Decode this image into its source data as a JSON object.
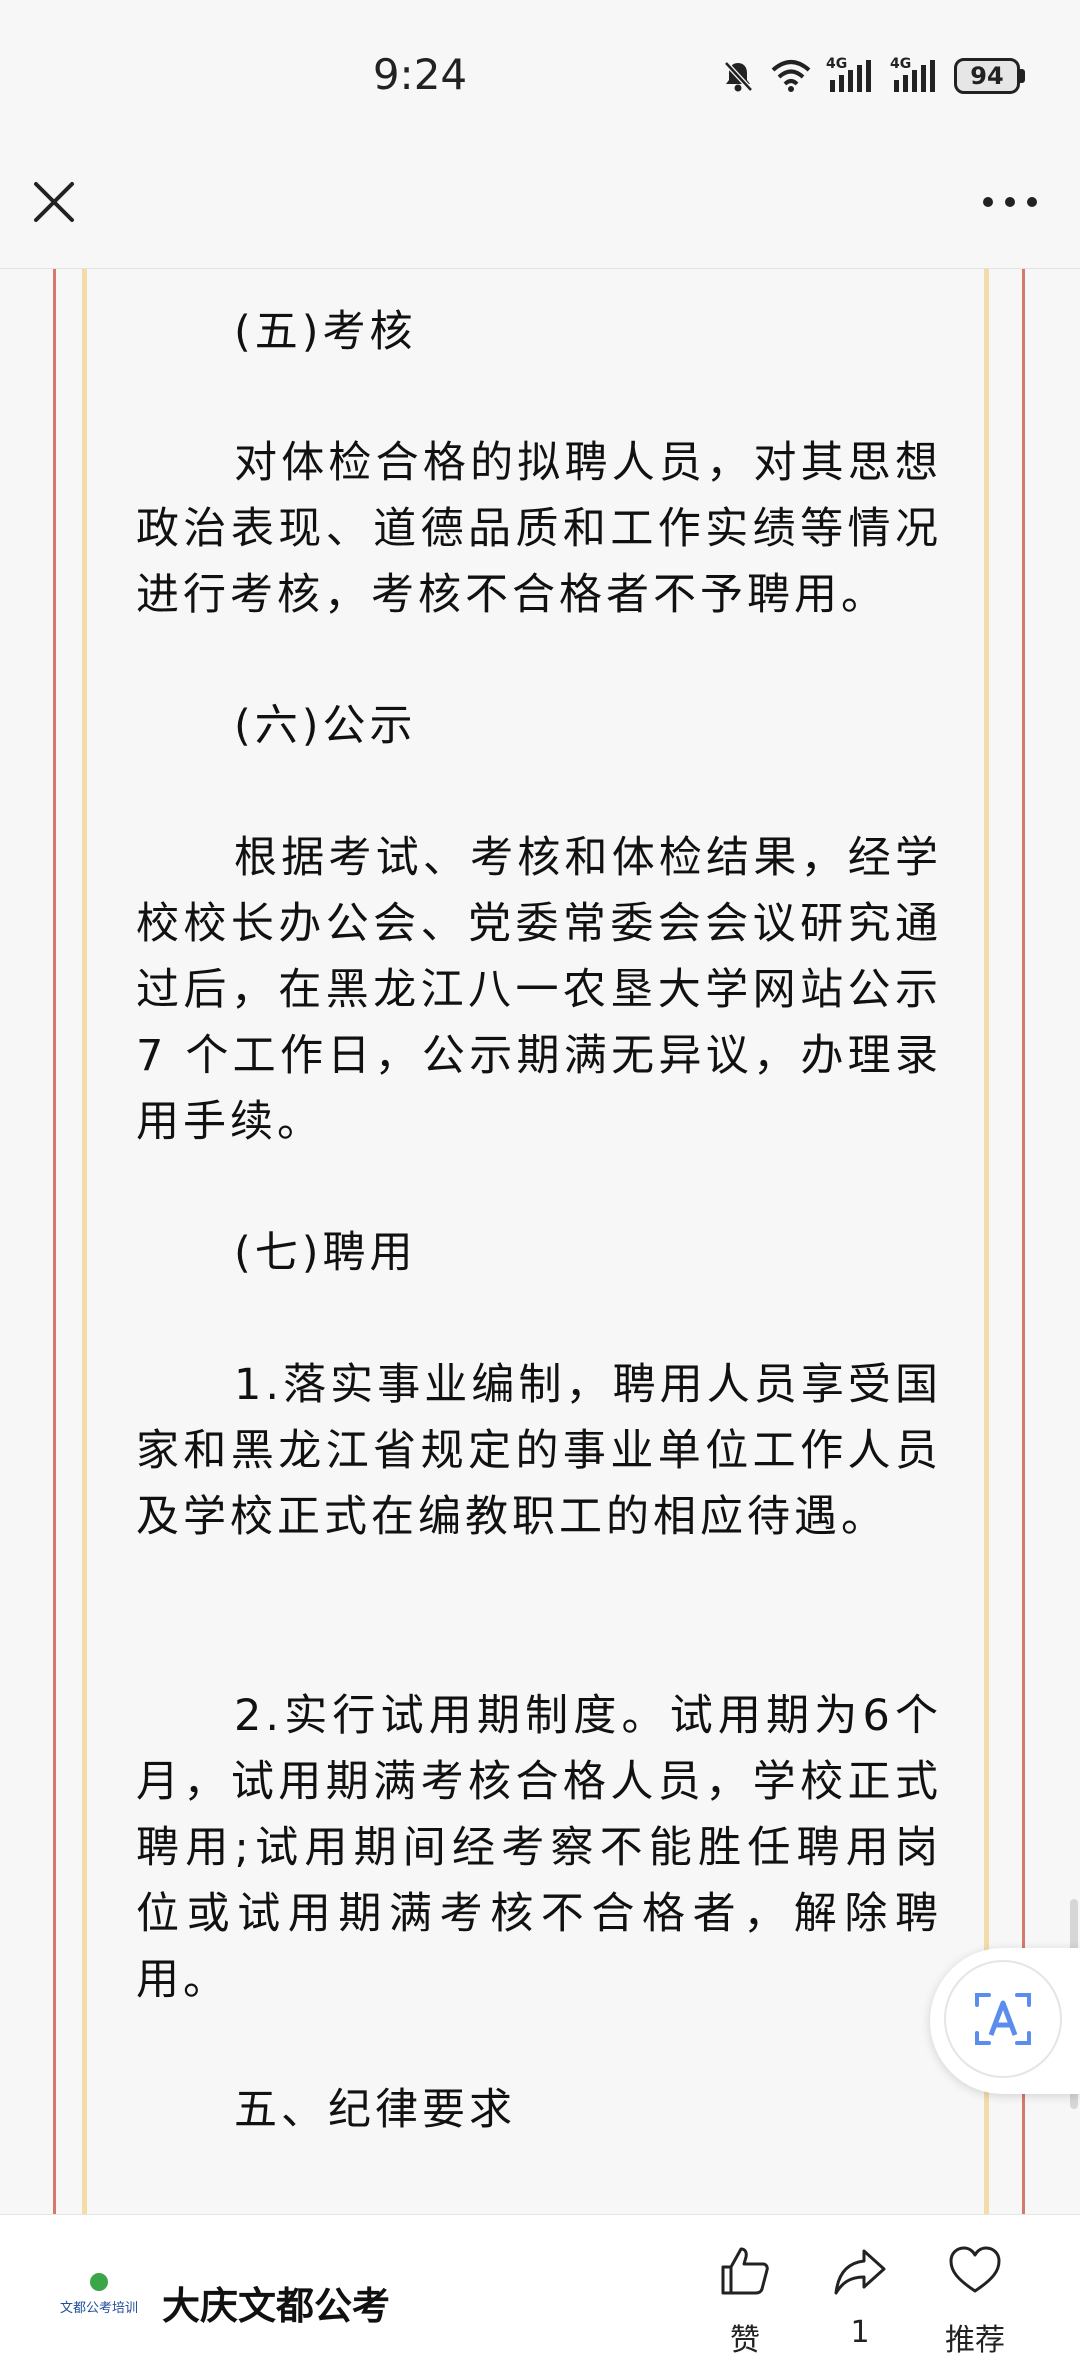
{
  "status": {
    "time": "9:24",
    "battery": "94",
    "network_1": "4G",
    "network_2": "4G"
  },
  "icons": {
    "close": "close-icon",
    "more": "more-icon",
    "like": "thumbs-up-icon",
    "share": "share-icon",
    "recommend": "heart-icon",
    "translate": "translate-icon",
    "mute": "bell-muted-icon",
    "wifi": "wifi-icon"
  },
  "article": {
    "paragraphs": [
      "(五)考核",
      "对体检合格的拟聘人员，对其思想政治表现、道德品质和工作实绩等情况进行考核，考核不合格者不予聘用。",
      "(六)公示",
      "根据考试、考核和体检结果，经学校校长办公会、党委常委会会议研究通过后，在黑龙江八一农垦大学网站公示7 个工作日，公示期满无异议，办理录用手续。",
      "(七)聘用",
      "1.落实事业编制，聘用人员享受国家和黑龙江省规定的事业单位工作人员及学校正式在编教职工的相应待遇。",
      "2.实行试用期制度。试用期为6个月，试用期满考核合格人员，学校正式聘用;试用期间经考察不能胜任聘用岗位或试用期满考核不合格者，解除聘用。",
      "五、纪律要求"
    ]
  },
  "bottom": {
    "logo_text": "文都公考培训",
    "account_name": "大庆文都公考",
    "like_label": "赞",
    "share_count": "1",
    "recommend_label": "推荐"
  },
  "colors": {
    "border_red": "#d47a6d",
    "border_gold": "#f3dca8",
    "translate_blue": "#5b8def",
    "logo_green": "#3aa648",
    "logo_blue": "#1f4e9c"
  }
}
